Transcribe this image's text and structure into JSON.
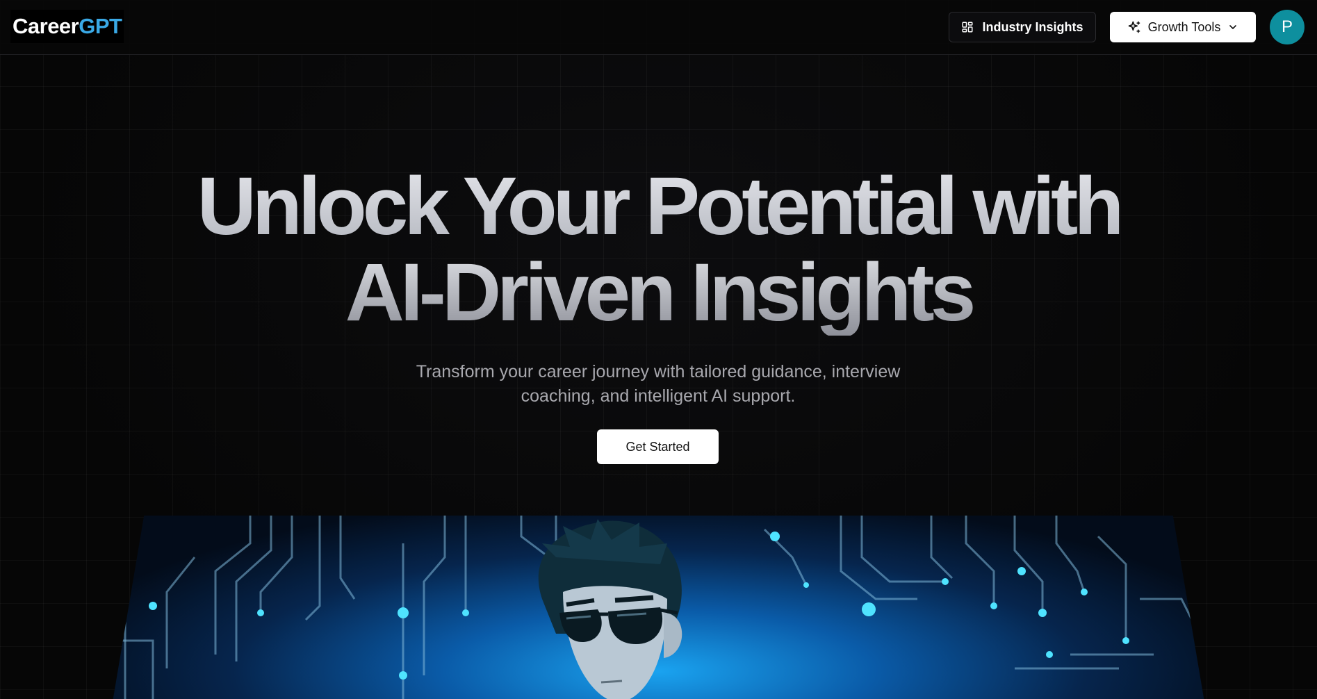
{
  "header": {
    "logo_part1": "Career",
    "logo_part2": "GPT",
    "insights_label": "Industry Insights",
    "growth_label": "Growth Tools",
    "avatar_initial": "P"
  },
  "hero": {
    "title_line1": "Unlock Your Potential with",
    "title_line2": "AI-Driven Insights",
    "subtitle": "Transform your career journey with tailored guidance, interview coaching, and intelligent AI support.",
    "cta_label": "Get Started"
  },
  "icons": {
    "insights": "layout-dashboard-icon",
    "growth": "sparkles-icon",
    "dropdown": "chevron-down-icon"
  },
  "colors": {
    "brand_accent": "#3aa9e6",
    "avatar_bg": "#0e8f9e",
    "banner_glow": "#1aa3f0"
  }
}
